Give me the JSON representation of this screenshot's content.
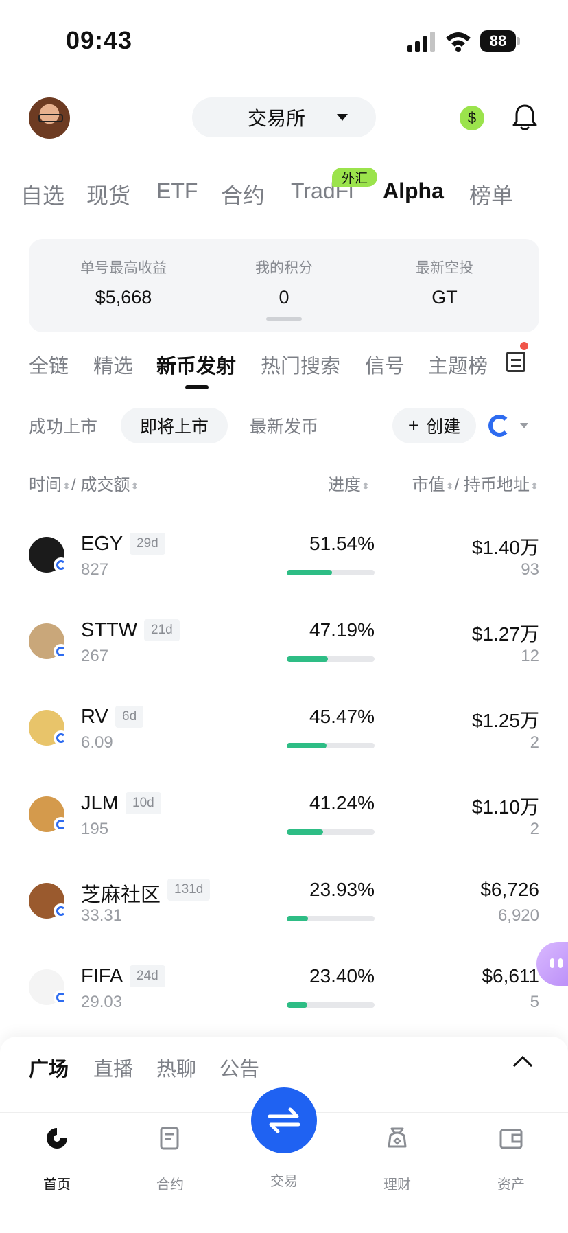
{
  "status_bar": {
    "time": "09:43",
    "battery": "88"
  },
  "header": {
    "exchange": "交易所"
  },
  "category_tabs": [
    "自选",
    "现货",
    "ETF",
    "合约",
    "TradFi",
    "Alpha",
    "榜单"
  ],
  "category_active": "Alpha",
  "fx_badge": "外汇",
  "summary": [
    {
      "label": "单号最高收益",
      "value": "$5,668"
    },
    {
      "label": "我的积分",
      "value": "0"
    },
    {
      "label": "最新空投",
      "value": "GT"
    }
  ],
  "sub_tabs": [
    "全链",
    "精选",
    "新币发射",
    "热门搜索",
    "信号",
    "主题榜"
  ],
  "sub_active": "新币发射",
  "filters": [
    "成功上市",
    "即将上市",
    "最新发币"
  ],
  "filter_active": "即将上市",
  "create_label": "创建",
  "columns": {
    "left": "时间",
    "left2": "成交额",
    "mid": "进度",
    "right1": "市值",
    "right2": "持币地址"
  },
  "tokens": [
    {
      "name": "EGY",
      "age": "29d",
      "volume": "827",
      "progress_text": "51.54%",
      "progress": 0.5154,
      "mcap": "$1.40万",
      "holders": "93",
      "logo_color": "#1b1b1b"
    },
    {
      "name": "STTW",
      "age": "21d",
      "volume": "267",
      "progress_text": "47.19%",
      "progress": 0.4719,
      "mcap": "$1.27万",
      "holders": "12",
      "logo_color": "#c9a77a"
    },
    {
      "name": "RV",
      "age": "6d",
      "volume": "6.09",
      "progress_text": "45.47%",
      "progress": 0.4547,
      "mcap": "$1.25万",
      "holders": "2",
      "logo_color": "#e8c46a"
    },
    {
      "name": "JLM",
      "age": "10d",
      "volume": "195",
      "progress_text": "41.24%",
      "progress": 0.4124,
      "mcap": "$1.10万",
      "holders": "2",
      "logo_color": "#d49a4c"
    },
    {
      "name": "芝麻社区",
      "age": "131d",
      "volume": "33.31",
      "progress_text": "23.93%",
      "progress": 0.2393,
      "mcap": "$6,726",
      "holders": "6,920",
      "logo_color": "#9a5a2e"
    },
    {
      "name": "FIFA",
      "age": "24d",
      "volume": "29.03",
      "progress_text": "23.40%",
      "progress": 0.234,
      "mcap": "$6,611",
      "holders": "5",
      "logo_color": "#f4f4f4"
    }
  ],
  "square_tabs": [
    "广场",
    "直播",
    "热聊",
    "公告"
  ],
  "square_active": "广场",
  "bottom_nav": [
    "首页",
    "合约",
    "交易",
    "理财",
    "资产"
  ],
  "bottom_active": "首页",
  "colors": {
    "accent": "#1f62f2",
    "progress": "#2ebd85",
    "lime": "#9be34c"
  }
}
